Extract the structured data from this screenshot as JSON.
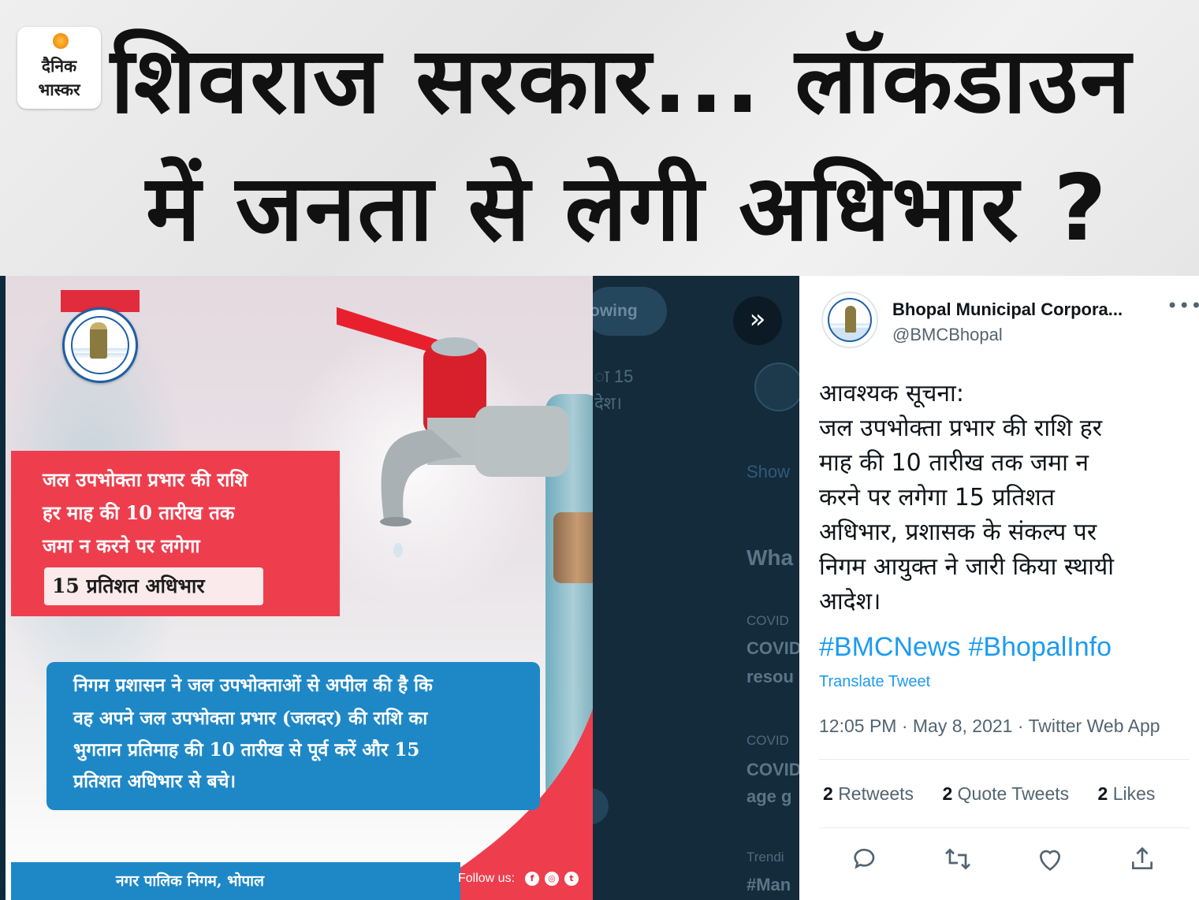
{
  "banner": {
    "logo_line1": "दैनिक",
    "logo_line2": "भास्कर",
    "headline_line1": "शिवराज सरकार... लॉकडाउन",
    "headline_line2": "में जनता से लेगी अधिभार ?"
  },
  "poster": {
    "red_lines": [
      "जल उपभोक्ता प्रभार की राशि",
      "हर माह की 10 तारीख तक",
      "जमा न करने पर लगेगा"
    ],
    "pill_text": "15 प्रतिशत अधिभार",
    "blue_lines": [
      "निगम प्रशासन ने जल उपभोक्ताओं से अपील की है कि",
      "वह अपने जल उपभोक्ता प्रभार (जलदर) की राशि का",
      "भुगतान प्रतिमाह की 10 तारीख से पूर्व करें और 15",
      "प्रतिशत अधिभार से बचे।"
    ],
    "footer_name": "नगर पालिक निगम, भोपाल",
    "follow_label": "Follow us:",
    "social_icons": [
      "facebook-icon",
      "instagram-icon",
      "twitter-icon"
    ],
    "colors": {
      "red": "#ee3e4e",
      "blue": "#1e88c7"
    }
  },
  "background_ui": {
    "follow_button_fragment": "owing",
    "tweet_fragment_1": "ा 15",
    "tweet_fragment_2": "देश।",
    "show_fragment": "Show",
    "whats_fragment": "Wha",
    "trend1_category": "COVID",
    "trend1_title": "COVID",
    "trend1_sub": "resou",
    "trend2_category": "COVID",
    "trend2_title": "COVID",
    "trend2_sub": "age g",
    "trend3_category": "Trendi",
    "trend3_title": "#Man"
  },
  "tweet": {
    "name": "Bhopal Municipal Corpora...",
    "handle": "@BMCBhopal",
    "body_lines": [
      "आवश्यक सूचना:",
      "जल उपभोक्ता प्रभार की राशि हर",
      "माह की 10 तारीख तक जमा न",
      "करने पर लगेगा 15 प्रतिशत",
      "अधिभार, प्रशासक के संकल्प पर",
      "निगम आयुक्त ने जारी किया स्थायी",
      "आदेश।"
    ],
    "hashtags": [
      "#BMCNews",
      "#BhopalInfo"
    ],
    "translate_label": "Translate Tweet",
    "meta": "12:05 PM · May 8, 2021 · Twitter Web App",
    "stats": {
      "retweets_count": "2",
      "retweets_label": "Retweets",
      "quotes_count": "2",
      "quotes_label": "Quote Tweets",
      "likes_count": "2",
      "likes_label": "Likes"
    },
    "colors": {
      "link": "#1d9bf0",
      "muted": "#536471"
    }
  }
}
